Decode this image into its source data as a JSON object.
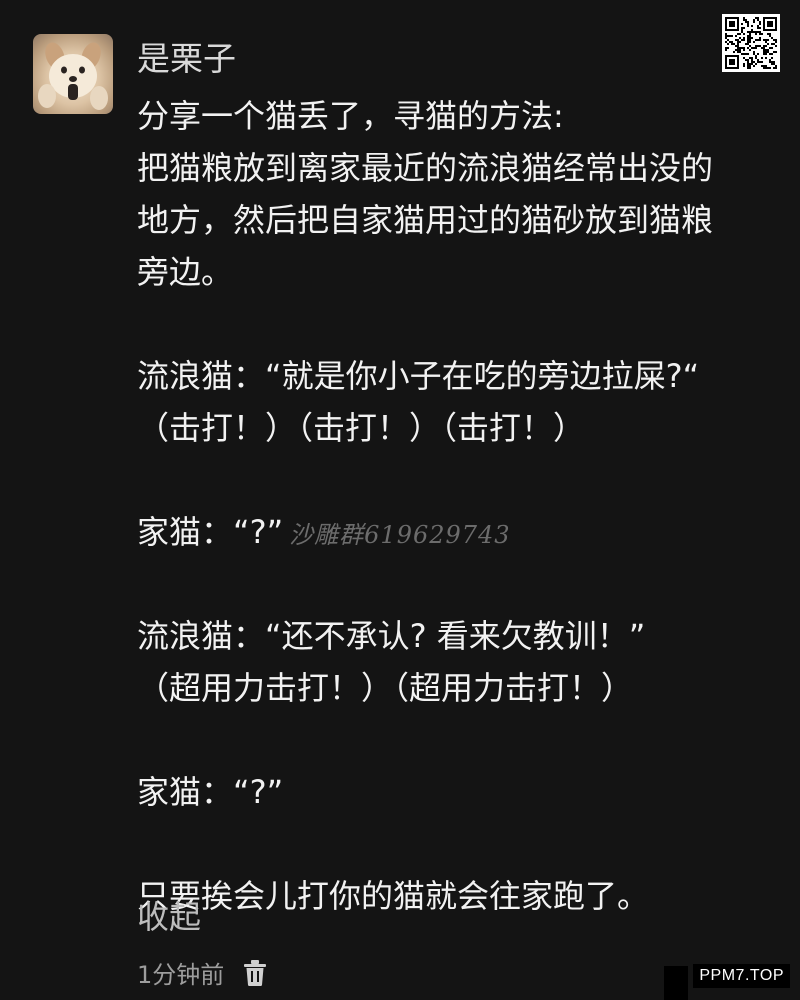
{
  "post": {
    "username": "是栗子",
    "lines": [
      "分享一个猫丢了，寻猫的方法:",
      "把猫粮放到离家最近的流浪猫经常出没的",
      "地方，然后把自家猫用过的猫砂放到猫粮",
      "旁边。",
      "",
      "流浪猫：“就是你小子在吃的旁边拉屎?“",
      "（击打！）（击打！）（击打！）",
      "",
      "家猫：“?”",
      "",
      "流浪猫：“还不承认? 看来欠教训！”",
      "（超用力击打！）（超用力击打！）",
      "",
      "家猫：“?”",
      "",
      "只要挨会儿打你的猫就会往家跑了。"
    ],
    "watermark_line_index": 8,
    "watermark_text": "沙雕群619629743",
    "collapse_label": "收起",
    "time_label": "1分钟前",
    "icons": {
      "trash": "trash-icon",
      "avatar": "dog-avatar"
    }
  },
  "site_tag": "PPM7.TOP",
  "colors": {
    "background": "#141414",
    "text": "#f2f2f2",
    "muted": "#9d9d9d"
  }
}
